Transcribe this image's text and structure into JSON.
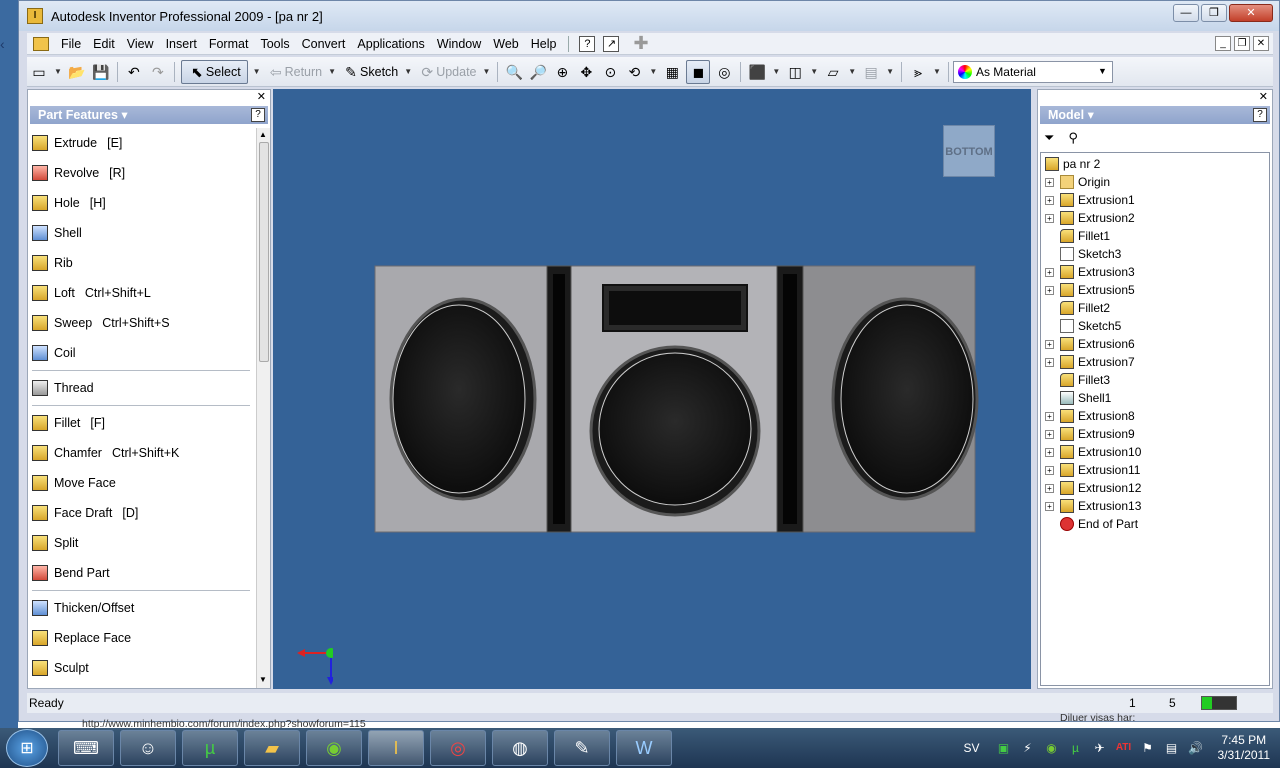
{
  "window": {
    "title": "Autodesk Inventor Professional 2009 - [pa nr 2]"
  },
  "menu": [
    "File",
    "Edit",
    "View",
    "Insert",
    "Format",
    "Tools",
    "Convert",
    "Applications",
    "Window",
    "Web",
    "Help"
  ],
  "toolbar": {
    "select_label": "Select",
    "return_label": "Return",
    "sketch_label": "Sketch",
    "update_label": "Update",
    "material_value": "As Material"
  },
  "left_panel": {
    "header": "Part Features",
    "features": [
      {
        "label": "Extrude",
        "shortcut": "[E]"
      },
      {
        "label": "Revolve",
        "shortcut": "[R]"
      },
      {
        "label": "Hole",
        "shortcut": "[H]"
      },
      {
        "label": "Shell",
        "shortcut": ""
      },
      {
        "label": "Rib",
        "shortcut": ""
      },
      {
        "label": "Loft",
        "shortcut": "Ctrl+Shift+L"
      },
      {
        "label": "Sweep",
        "shortcut": "Ctrl+Shift+S"
      },
      {
        "label": "Coil",
        "shortcut": ""
      },
      {
        "label": "Thread",
        "shortcut": ""
      },
      {
        "label": "Fillet",
        "shortcut": "[F]"
      },
      {
        "label": "Chamfer",
        "shortcut": "Ctrl+Shift+K"
      },
      {
        "label": "Move Face",
        "shortcut": ""
      },
      {
        "label": "Face Draft",
        "shortcut": "[D]"
      },
      {
        "label": "Split",
        "shortcut": ""
      },
      {
        "label": "Bend Part",
        "shortcut": ""
      },
      {
        "label": "Thicken/Offset",
        "shortcut": ""
      },
      {
        "label": "Replace Face",
        "shortcut": ""
      },
      {
        "label": "Sculpt",
        "shortcut": ""
      }
    ]
  },
  "viewcube_label": "BOTTOM",
  "right_panel": {
    "header": "Model",
    "root": "pa nr 2",
    "nodes": [
      {
        "label": "Origin",
        "expandable": true,
        "kind": "folder"
      },
      {
        "label": "Extrusion1",
        "expandable": true,
        "kind": "extrude"
      },
      {
        "label": "Extrusion2",
        "expandable": true,
        "kind": "extrude"
      },
      {
        "label": "Fillet1",
        "expandable": false,
        "kind": "fillet"
      },
      {
        "label": "Sketch3",
        "expandable": false,
        "kind": "sketch"
      },
      {
        "label": "Extrusion3",
        "expandable": true,
        "kind": "extrude"
      },
      {
        "label": "Extrusion5",
        "expandable": true,
        "kind": "extrude"
      },
      {
        "label": "Fillet2",
        "expandable": false,
        "kind": "fillet"
      },
      {
        "label": "Sketch5",
        "expandable": false,
        "kind": "sketch"
      },
      {
        "label": "Extrusion6",
        "expandable": true,
        "kind": "extrude"
      },
      {
        "label": "Extrusion7",
        "expandable": true,
        "kind": "extrude"
      },
      {
        "label": "Fillet3",
        "expandable": false,
        "kind": "fillet"
      },
      {
        "label": "Shell1",
        "expandable": false,
        "kind": "shell"
      },
      {
        "label": "Extrusion8",
        "expandable": true,
        "kind": "extrude"
      },
      {
        "label": "Extrusion9",
        "expandable": true,
        "kind": "extrude"
      },
      {
        "label": "Extrusion10",
        "expandable": true,
        "kind": "extrude"
      },
      {
        "label": "Extrusion11",
        "expandable": true,
        "kind": "extrude"
      },
      {
        "label": "Extrusion12",
        "expandable": true,
        "kind": "extrude"
      },
      {
        "label": "Extrusion13",
        "expandable": true,
        "kind": "extrude"
      },
      {
        "label": "End of Part",
        "expandable": false,
        "kind": "end"
      }
    ]
  },
  "status": {
    "text": "Ready",
    "value1": "1",
    "value2": "5"
  },
  "background": {
    "url_text": "http://www.minhembio.com/forum/index.php?showforum=115",
    "right_text": "Diluer visas har:"
  },
  "taskbar": {
    "lang": "SV",
    "time": "7:45 PM",
    "date": "3/31/2011"
  },
  "colors": {
    "viewport": "#346297",
    "panel_header": "#8fa4cc"
  }
}
